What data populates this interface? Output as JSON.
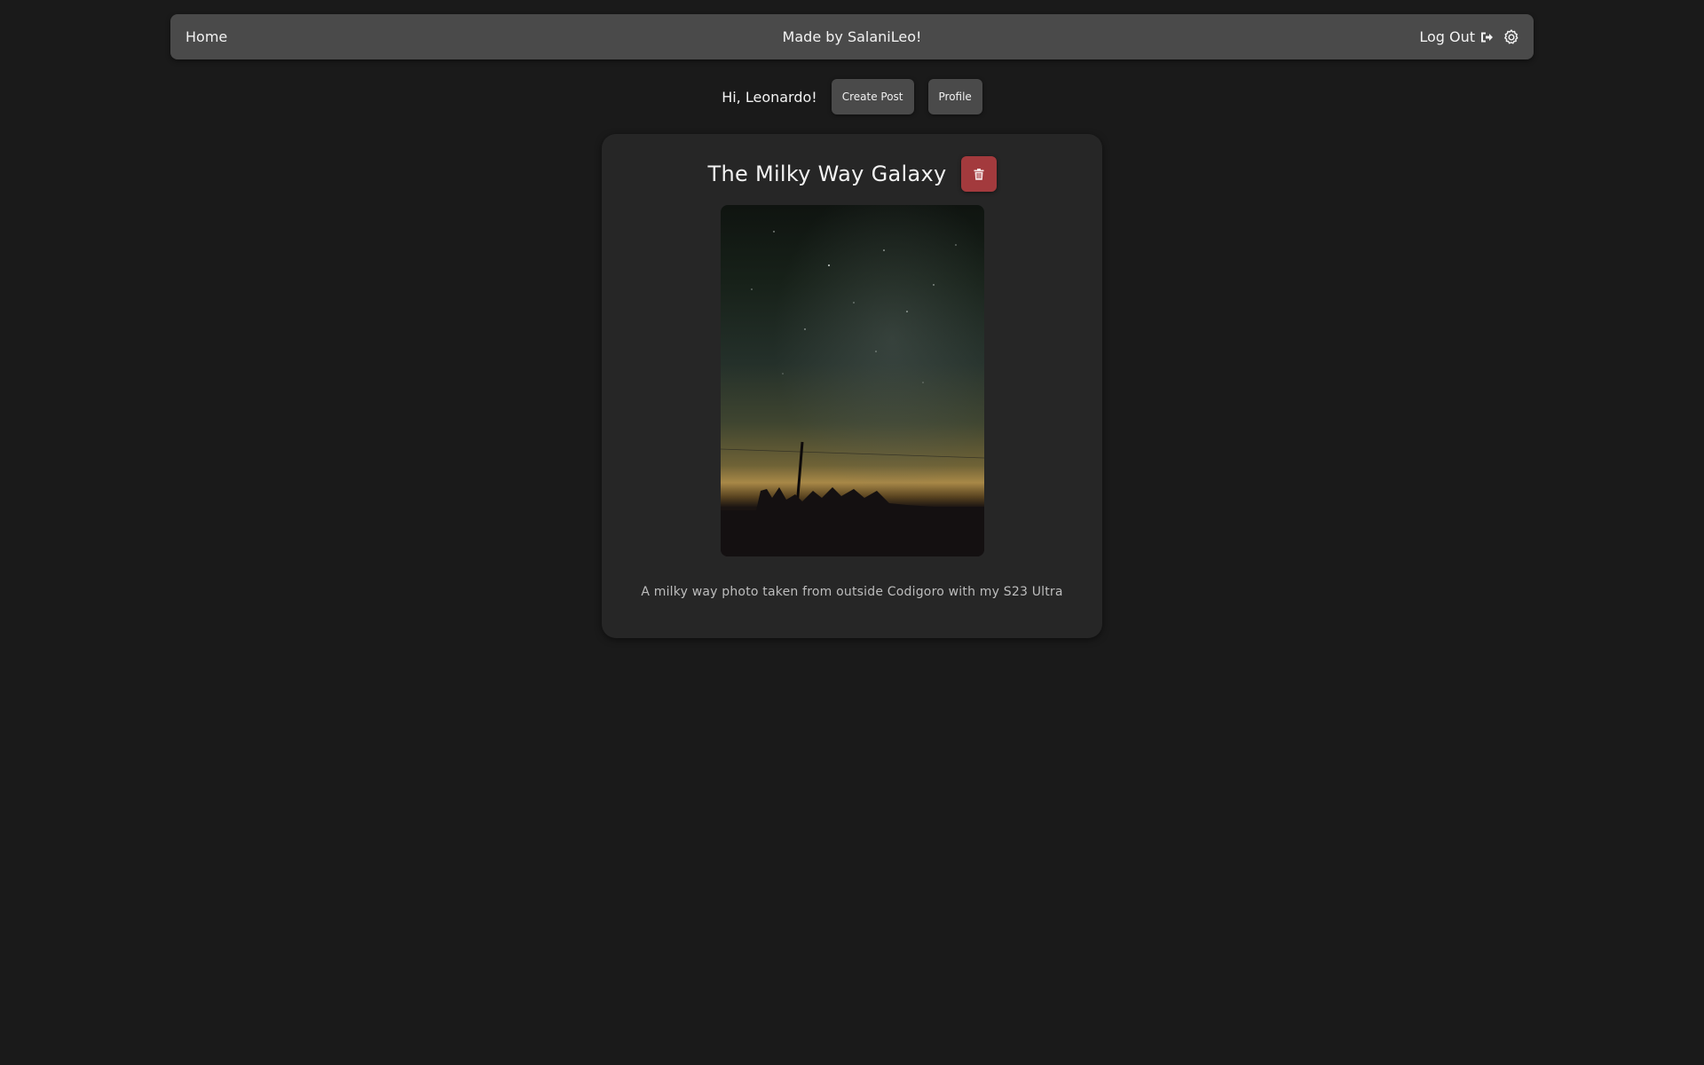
{
  "navbar": {
    "home_label": "Home",
    "center_text": "Made by SalaniLeo!",
    "logout_label": "Log Out",
    "logout_icon": "sign-out-icon",
    "settings_icon": "gear-icon"
  },
  "userbar": {
    "greeting": "Hi, Leonardo!",
    "create_post_label": "Create Post",
    "profile_label": "Profile"
  },
  "post": {
    "title": "The Milky Way Galaxy",
    "delete_icon": "trash-icon",
    "image_alt": "Milky way night sky over a field with a utility pole silhouette",
    "caption": "A milky way photo taken from outside Codigoro with my S23 Ultra"
  },
  "colors": {
    "background": "#1a1a1a",
    "navbar": "#4a4a4a",
    "card": "#262626",
    "button": "#4a4a4a",
    "delete": "#a33a3d"
  }
}
